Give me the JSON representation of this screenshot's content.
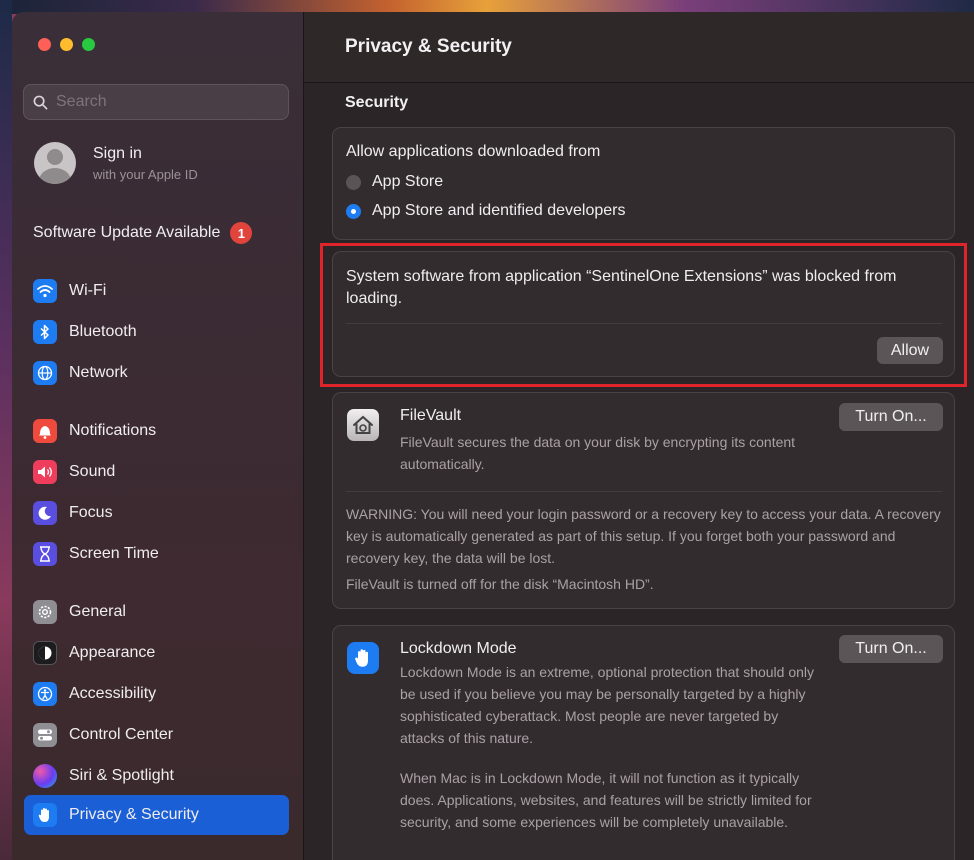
{
  "window": {
    "title": "Privacy & Security"
  },
  "search": {
    "placeholder": "Search"
  },
  "account": {
    "title": "Sign in",
    "subtitle": "with your Apple ID"
  },
  "software_update": {
    "label": "Software Update Available",
    "badge": "1"
  },
  "sidebar": {
    "items": [
      {
        "label": "Wi-Fi",
        "icon": "wifi-icon"
      },
      {
        "label": "Bluetooth",
        "icon": "bluetooth-icon"
      },
      {
        "label": "Network",
        "icon": "globe-icon"
      },
      {
        "label": "Notifications",
        "icon": "bell-icon"
      },
      {
        "label": "Sound",
        "icon": "speaker-icon"
      },
      {
        "label": "Focus",
        "icon": "moon-icon"
      },
      {
        "label": "Screen Time",
        "icon": "hourglass-icon"
      },
      {
        "label": "General",
        "icon": "gear-icon"
      },
      {
        "label": "Appearance",
        "icon": "appearance-icon"
      },
      {
        "label": "Accessibility",
        "icon": "accessibility-icon"
      },
      {
        "label": "Control Center",
        "icon": "toggles-icon"
      },
      {
        "label": "Siri & Spotlight",
        "icon": "siri-icon"
      },
      {
        "label": "Privacy & Security",
        "icon": "hand-icon",
        "active": true
      }
    ]
  },
  "main": {
    "title": "Privacy & Security",
    "section": "Security",
    "allow_apps": {
      "title": "Allow applications downloaded from",
      "options": [
        {
          "label": "App Store",
          "selected": false
        },
        {
          "label": "App Store and identified developers",
          "selected": true
        }
      ]
    },
    "blocked": {
      "text": "System software from application “SentinelOne Extensions” was blocked from loading.",
      "button": "Allow"
    },
    "filevault": {
      "title": "FileVault",
      "description": "FileVault secures the data on your disk by encrypting its content automatically.",
      "button": "Turn On...",
      "warning": "WARNING: You will need your login password or a recovery key to access your data. A recovery key is automatically generated as part of this setup. If you forget both your password and recovery key, the data will be lost.",
      "status": "FileVault is turned off for the disk “Macintosh HD”."
    },
    "lockdown": {
      "title": "Lockdown Mode",
      "description": "Lockdown Mode is an extreme, optional protection that should only be used if you believe you may be personally targeted by a highly sophisticated cyberattack. Most people are never targeted by attacks of this nature.",
      "description2": "When Mac is in Lockdown Mode, it will not function as it typically does. Applications, websites, and features will be strictly limited for security, and some experiences will be completely unavailable.",
      "button": "Turn On..."
    }
  },
  "colors": {
    "accent": "#1b5fd6",
    "highlight_box": "#e0242c",
    "badge": "#e0443c"
  }
}
